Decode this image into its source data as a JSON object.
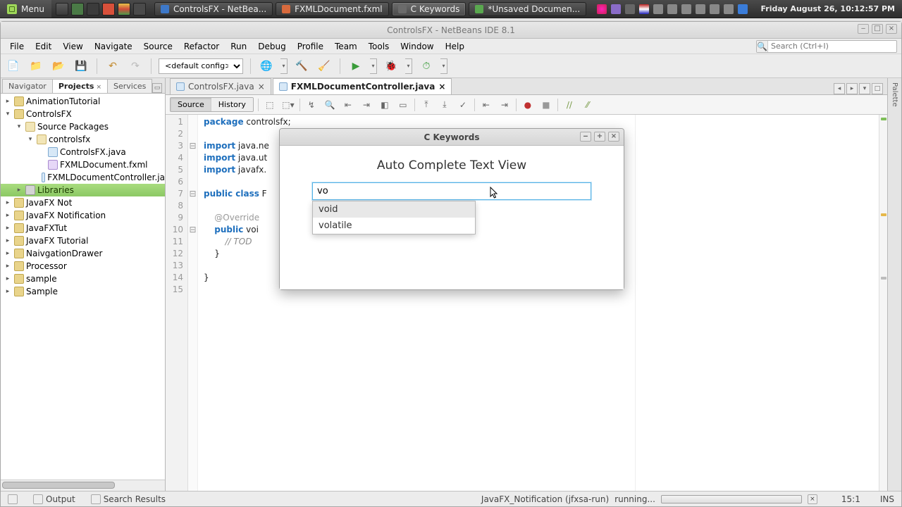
{
  "os": {
    "menu_label": "Menu",
    "tasks": [
      {
        "label": "ControlsFX - NetBea...",
        "color": "#3d78c8",
        "active": false
      },
      {
        "label": "FXMLDocument.fxml",
        "color": "#d86a3d",
        "active": false
      },
      {
        "label": "C Keywords",
        "color": "#6b6b6b",
        "active": true
      },
      {
        "label": "*Unsaved Documen...",
        "color": "#5aa84f",
        "active": false
      }
    ],
    "clock": "Friday August 26, 10:12:57 PM"
  },
  "ide": {
    "title": "ControlsFX - NetBeans IDE 8.1",
    "menus": [
      "File",
      "Edit",
      "View",
      "Navigate",
      "Source",
      "Refactor",
      "Run",
      "Debug",
      "Profile",
      "Team",
      "Tools",
      "Window",
      "Help"
    ],
    "search_placeholder": "Search (Ctrl+I)",
    "config_selected": "<default config>",
    "left_tabs": [
      "Navigator",
      "Projects",
      "Services"
    ],
    "left_active": 1,
    "tree": [
      {
        "d": 0,
        "tw": "▸",
        "icon": "proj",
        "label": "AnimationTutorial"
      },
      {
        "d": 0,
        "tw": "▾",
        "icon": "proj",
        "label": "ControlsFX"
      },
      {
        "d": 1,
        "tw": "▾",
        "icon": "pkg",
        "label": "Source Packages"
      },
      {
        "d": 2,
        "tw": "▾",
        "icon": "pkg",
        "label": "controlsfx"
      },
      {
        "d": 3,
        "tw": "",
        "icon": "java",
        "label": "ControlsFX.java"
      },
      {
        "d": 3,
        "tw": "",
        "icon": "fxml",
        "label": "FXMLDocument.fxml"
      },
      {
        "d": 3,
        "tw": "",
        "icon": "java",
        "label": "FXMLDocumentController.ja"
      },
      {
        "d": 1,
        "tw": "▸",
        "icon": "lib",
        "label": "Libraries",
        "selected": true
      },
      {
        "d": 0,
        "tw": "▸",
        "icon": "proj",
        "label": "JavaFX Not"
      },
      {
        "d": 0,
        "tw": "▸",
        "icon": "proj",
        "label": "JavaFX Notification"
      },
      {
        "d": 0,
        "tw": "▸",
        "icon": "proj",
        "label": "JavaFXTut"
      },
      {
        "d": 0,
        "tw": "▸",
        "icon": "proj",
        "label": "JavaFX Tutorial"
      },
      {
        "d": 0,
        "tw": "▸",
        "icon": "proj",
        "label": "NaivgationDrawer"
      },
      {
        "d": 0,
        "tw": "▸",
        "icon": "proj",
        "label": "Processor"
      },
      {
        "d": 0,
        "tw": "▸",
        "icon": "proj",
        "label": "sample"
      },
      {
        "d": 0,
        "tw": "▸",
        "icon": "proj",
        "label": "Sample"
      }
    ],
    "editor_tabs": [
      {
        "label": "ControlsFX.java",
        "active": false
      },
      {
        "label": "FXMLDocumentController.java",
        "active": true
      }
    ],
    "src_hist": [
      "Source",
      "History"
    ],
    "code_lines": [
      {
        "n": 1,
        "fold": "",
        "html": "<span class='kw'>package</span> controlsfx;"
      },
      {
        "n": 2,
        "fold": "",
        "html": ""
      },
      {
        "n": 3,
        "fold": "⊟",
        "html": "<span class='kw'>import</span> java.ne"
      },
      {
        "n": 4,
        "fold": "",
        "html": "<span class='kw'>import</span> java.ut"
      },
      {
        "n": 5,
        "fold": "",
        "html": "<span class='kw'>import</span> javafx."
      },
      {
        "n": 6,
        "fold": "",
        "html": ""
      },
      {
        "n": 7,
        "fold": "⊟",
        "html": "<span class='kw'>public class</span> F"
      },
      {
        "n": 8,
        "fold": "",
        "html": ""
      },
      {
        "n": 9,
        "fold": "",
        "html": "    <span class='ann'>@Override</span>"
      },
      {
        "n": 10,
        "fold": "⊟",
        "html": "    <span class='kw'>public</span> voi"
      },
      {
        "n": 11,
        "fold": "",
        "html": "        <span class='cm'>// TOD</span>"
      },
      {
        "n": 12,
        "fold": "",
        "html": "    }"
      },
      {
        "n": 13,
        "fold": "",
        "html": ""
      },
      {
        "n": 14,
        "fold": "",
        "html": "}"
      },
      {
        "n": 15,
        "fold": "",
        "html": ""
      }
    ],
    "statusbar": {
      "output": "Output",
      "search": "Search Results",
      "run_task": "JavaFX_Notification (jfxsa-run)",
      "run_state": "running...",
      "lncol": "15:1",
      "ins": "INS"
    }
  },
  "app": {
    "title": "C Keywords",
    "heading": "Auto Complete Text View",
    "input_value": "vo",
    "suggestions": [
      "void",
      "volatile"
    ],
    "selected": 0
  },
  "palette_label": "Palette"
}
